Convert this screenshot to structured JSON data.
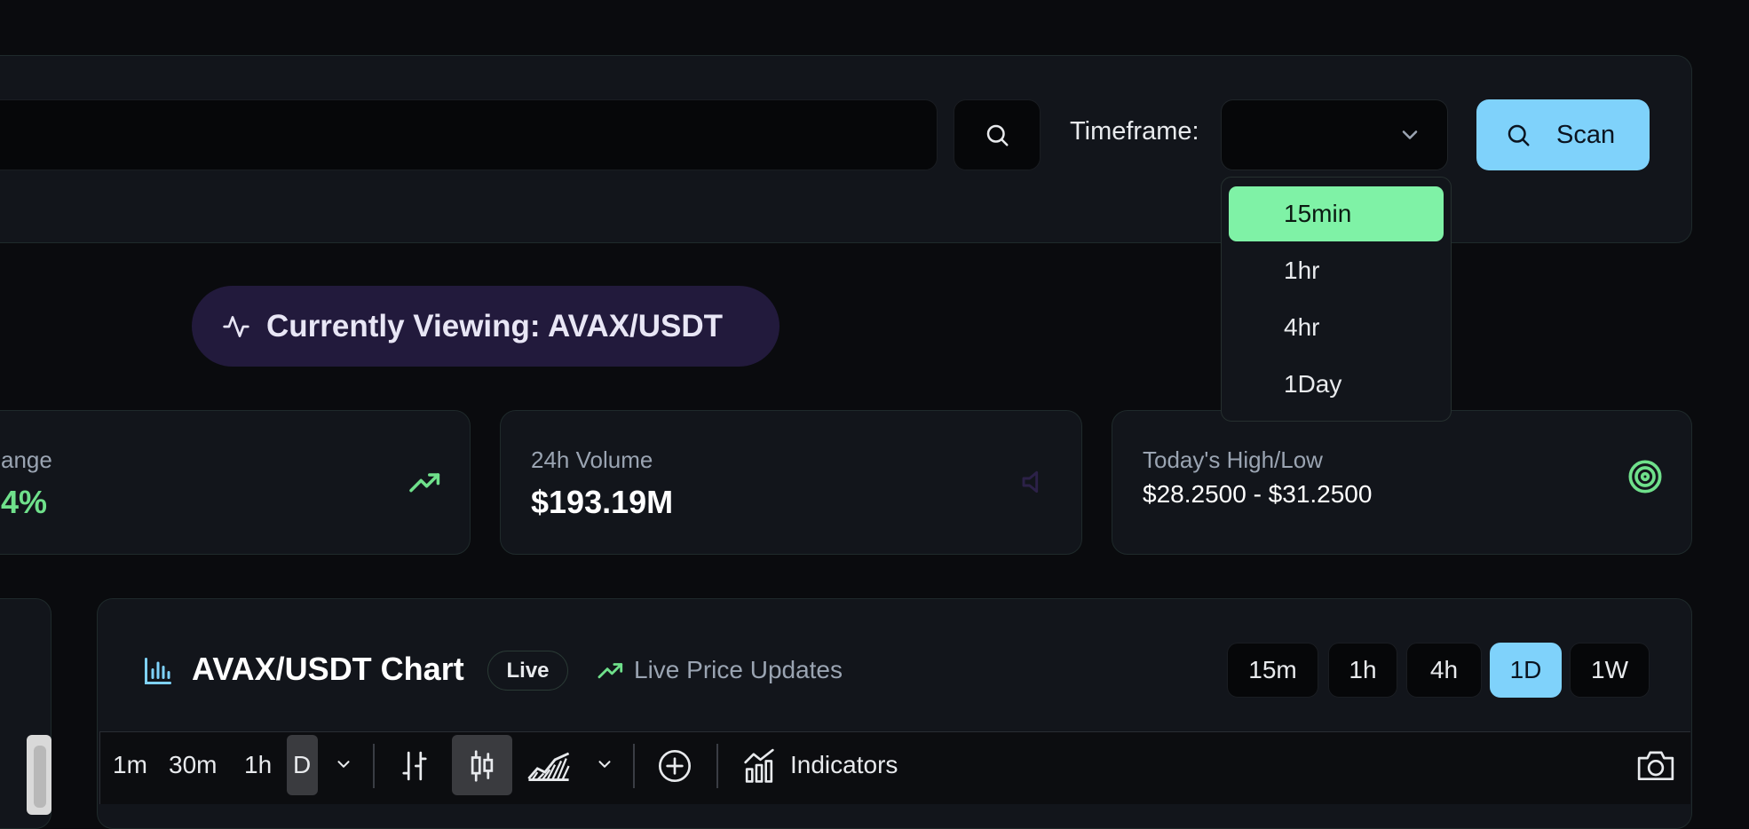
{
  "search": {
    "value": "",
    "placeholder": ""
  },
  "timeframe": {
    "label": "Timeframe:",
    "selected": "",
    "options": [
      "15min",
      "1hr",
      "4hr",
      "1Day"
    ],
    "highlighted": "15min"
  },
  "scan_button": {
    "label": "Scan"
  },
  "viewing": {
    "text": "Currently Viewing: AVAX/USDT"
  },
  "stats": {
    "change": {
      "label": "ange",
      "value": "4%"
    },
    "volume": {
      "label": "24h Volume",
      "value": "$193.19M"
    },
    "high_low": {
      "label": "Today's High/Low",
      "value": "$28.2500 - $31.2500"
    }
  },
  "chart": {
    "title": "AVAX/USDT Chart",
    "badge": "Live",
    "live_updates": "Live Price Updates",
    "timeframes": [
      "15m",
      "1h",
      "4h",
      "1D",
      "1W"
    ],
    "active_timeframe": "1D"
  },
  "toolbar": {
    "intervals": [
      "1m",
      "30m",
      "1h",
      "D"
    ],
    "active_interval": "D",
    "indicators_label": "Indicators"
  },
  "colors": {
    "background": "#0a0b0e",
    "panel": "#12151b",
    "accent_blue": "#7fd2fb",
    "accent_green": "#7ff2a6",
    "positive": "#6fe08b",
    "pill_purple": "#221a3c"
  }
}
